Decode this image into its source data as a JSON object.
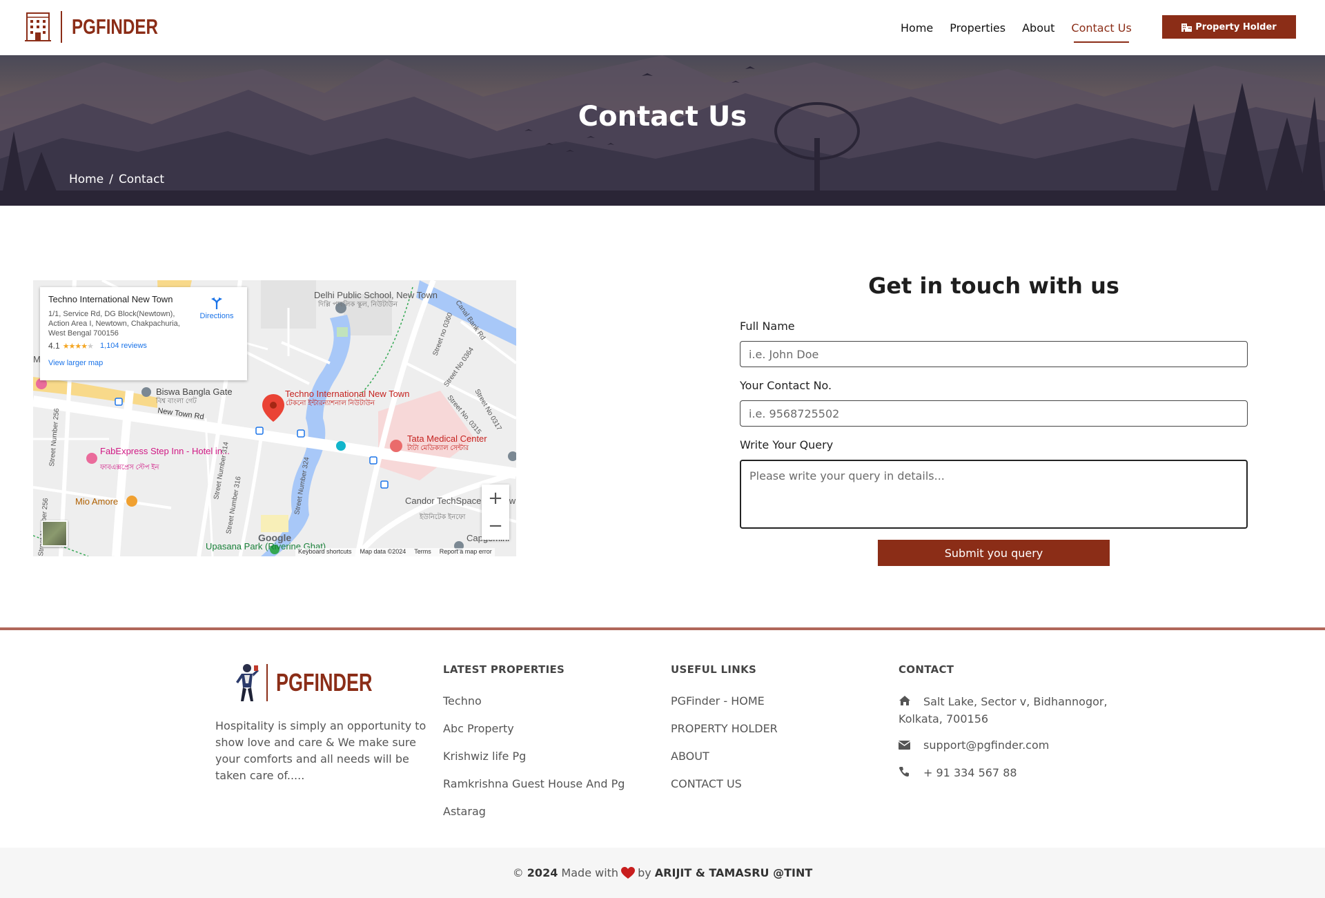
{
  "brand": {
    "name": "PGFINDER",
    "logo_icon": "building-icon"
  },
  "nav": {
    "links": [
      "Home",
      "Properties",
      "About",
      "Contact Us"
    ],
    "active": "Contact Us",
    "cta_label": "Property Holder",
    "cta_icon": "building-icon"
  },
  "colors": {
    "accent": "#8b2d17",
    "footer_border": "#b0675a"
  },
  "hero": {
    "title": "Contact Us",
    "breadcrumb": [
      "Home",
      "Contact"
    ]
  },
  "map": {
    "card_title": "Techno International New Town",
    "card_address": "1/1, Service Rd, DG Block(Newtown), Action Area I, Newtown, Chakpachuria, West Bengal 700156",
    "rating": "4.1",
    "reviews": "1,104 reviews",
    "larger_map": "View larger map",
    "directions": "Directions",
    "brand": "Google",
    "footer": [
      "Keyboard shortcuts",
      "Map data ©2024",
      "Terms",
      "Report a map error"
    ],
    "labels": {
      "delhi": "Delhi Public School, New Town",
      "delhi_bn": "দিল্লি পাবলিক স্কুল, নিউটাউন",
      "biswa": "Biswa Bangla Gate",
      "biswa_bn": "বিশ্ব বাংলা গেট",
      "techno": "Techno International New Town",
      "techno_bn": "টেকনো ইন্টারন্যাশনাল নিউটাউন",
      "tata": "Tata Medical Center",
      "tata_bn": "টাটা মেডিক্যাল সেন্টার",
      "fab": "FabExpress Step Inn - Hotel in...",
      "fab_bn": "ফাবএক্সপ্রেস স্টেপ ইন",
      "mio": "Mio Amore",
      "candor": "Candor TechSpace Newtown, Kolkata",
      "candor_bn": "ইউনিটেক ইনফো",
      "capgemini": "Capgemini",
      "upasana": "Upasana Park (Riverine Ghat)",
      "newtown_rd": "New Town Rd",
      "canal": "Canal Bank Rd",
      "st360": "Street no 0360",
      "st364": "Street No 0364",
      "st317": "Street No 0317",
      "st315": "Street No. 0315",
      "st256": "Street Number 256",
      "st256b": "Street Number 256",
      "st314": "Street Number 314",
      "st316": "Street Number 316",
      "st324": "Street Number 324",
      "edge_m": "M"
    }
  },
  "form": {
    "title": "Get in touch with us",
    "full_name_label": "Full Name",
    "full_name_placeholder": "i.e. John Doe",
    "contact_label": "Your Contact No.",
    "contact_placeholder": "i.e. 9568725502",
    "query_label": "Write Your Query",
    "query_placeholder": "Please write your query in details...",
    "submit_label": "Submit you query"
  },
  "footer": {
    "brand": "PGFINDER",
    "about": "Hospitality is simply an opportunity to show love and care & We make sure your comforts and all needs will be taken care of.....",
    "latest_title": "LATEST PROPERTIES",
    "latest": [
      "Techno",
      "Abc Property",
      "Krishwiz life Pg",
      "Ramkrishna Guest House And Pg",
      "Astarag"
    ],
    "useful_title": "USEFUL LINKS",
    "useful": [
      "PGFinder - HOME",
      "PROPERTY HOLDER",
      "ABOUT",
      "CONTACT US"
    ],
    "contact_title": "CONTACT",
    "address": "Salt Lake, Sector v, Bidhannogor, Kolkata, 700156",
    "email": "support@pgfinder.com",
    "phone": "+ 91 334 567 88",
    "icons": [
      "home-icon",
      "envelope-icon",
      "phone-icon"
    ]
  },
  "copyright": {
    "prefix": "©",
    "year": "2024",
    "made_with": "Made with",
    "by": "by",
    "authors": "ARIJIT & TAMASRU @TINT"
  }
}
